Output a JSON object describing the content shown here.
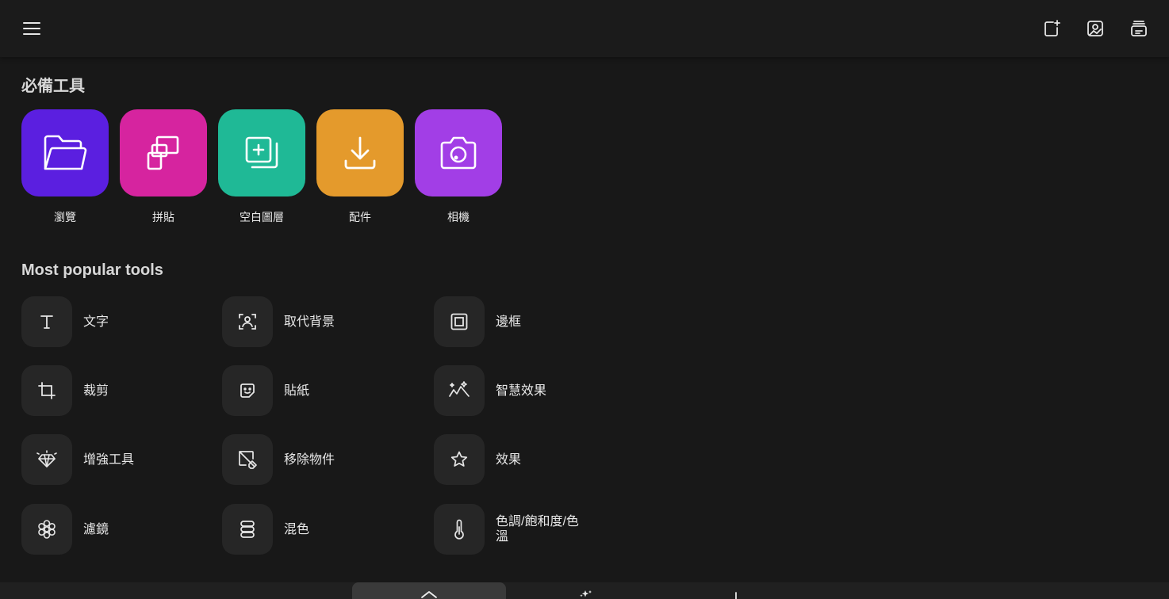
{
  "header": {
    "menu_icon": "hamburger-menu-icon",
    "actions": [
      {
        "icon": "new-canvas-icon"
      },
      {
        "icon": "image-portrait-icon"
      },
      {
        "icon": "projects-stack-icon"
      }
    ]
  },
  "essentials": {
    "title": "必備工具",
    "items": [
      {
        "label": "瀏覽",
        "icon": "folder-icon",
        "color": "#5b1fe0"
      },
      {
        "label": "拼貼",
        "icon": "collage-icon",
        "color": "#d6249f"
      },
      {
        "label": "空白圖層",
        "icon": "blank-layer-icon",
        "color": "#1fb996"
      },
      {
        "label": "配件",
        "icon": "download-icon",
        "color": "#e49a2c"
      },
      {
        "label": "相機",
        "icon": "camera-icon",
        "color": "#a23ee6"
      }
    ]
  },
  "popular": {
    "title": "Most popular tools",
    "items": [
      {
        "label": "文字",
        "icon": "text-icon"
      },
      {
        "label": "取代背景",
        "icon": "replace-background-icon"
      },
      {
        "label": "邊框",
        "icon": "border-icon"
      },
      {
        "label": "裁剪",
        "icon": "crop-icon"
      },
      {
        "label": "貼紙",
        "icon": "sticker-icon"
      },
      {
        "label": "智慧效果",
        "icon": "smart-effects-icon"
      },
      {
        "label": "增強工具",
        "icon": "enhance-diamond-icon"
      },
      {
        "label": "移除物件",
        "icon": "remove-object-icon"
      },
      {
        "label": "效果",
        "icon": "star-icon"
      },
      {
        "label": "濾鏡",
        "icon": "filter-flower-icon"
      },
      {
        "label": "混色",
        "icon": "blend-layers-icon"
      },
      {
        "label": "色調/飽和度/色溫",
        "icon": "thermometer-icon"
      }
    ]
  },
  "bottom_nav": {
    "items": [
      {
        "icon": "home-icon",
        "active": true
      },
      {
        "icon": "sparkle-icon"
      },
      {
        "icon": "add-icon"
      }
    ]
  },
  "colors": {
    "background": "#181818",
    "tile_bg": "#262626"
  }
}
